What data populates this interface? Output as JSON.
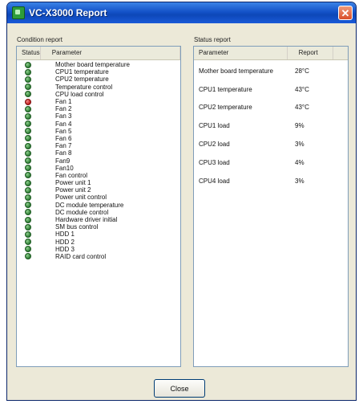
{
  "window": {
    "title": "VC-X3000 Report"
  },
  "condition": {
    "label": "Condition report",
    "col_status": "Status",
    "col_parameter": "Parameter",
    "rows": [
      {
        "status": "ok",
        "parameter": "Mother board temperature"
      },
      {
        "status": "ok",
        "parameter": "CPU1 temperature"
      },
      {
        "status": "ok",
        "parameter": "CPU2 temperature"
      },
      {
        "status": "ok",
        "parameter": "Temperature control"
      },
      {
        "status": "ok",
        "parameter": "CPU load control"
      },
      {
        "status": "error",
        "parameter": "Fan 1"
      },
      {
        "status": "ok",
        "parameter": "Fan 2"
      },
      {
        "status": "ok",
        "parameter": "Fan 3"
      },
      {
        "status": "ok",
        "parameter": "Fan 4"
      },
      {
        "status": "ok",
        "parameter": "Fan 5"
      },
      {
        "status": "ok",
        "parameter": "Fan 6"
      },
      {
        "status": "ok",
        "parameter": "Fan 7"
      },
      {
        "status": "ok",
        "parameter": "Fan 8"
      },
      {
        "status": "ok",
        "parameter": "Fan9"
      },
      {
        "status": "ok",
        "parameter": "Fan10"
      },
      {
        "status": "ok",
        "parameter": "Fan control"
      },
      {
        "status": "ok",
        "parameter": "Power unit 1"
      },
      {
        "status": "ok",
        "parameter": "Power unit 2"
      },
      {
        "status": "ok",
        "parameter": "Power unit control"
      },
      {
        "status": "ok",
        "parameter": "DC module temperature"
      },
      {
        "status": "ok",
        "parameter": "DC module control"
      },
      {
        "status": "ok",
        "parameter": "Hardware driver initial"
      },
      {
        "status": "ok",
        "parameter": "SM bus control"
      },
      {
        "status": "ok",
        "parameter": "HDD 1"
      },
      {
        "status": "ok",
        "parameter": "HDD 2"
      },
      {
        "status": "ok",
        "parameter": "HDD 3"
      },
      {
        "status": "ok",
        "parameter": "RAID card control"
      }
    ]
  },
  "status": {
    "label": "Status report",
    "col_parameter": "Parameter",
    "col_report": "Report",
    "rows": [
      {
        "parameter": "Mother board temperature",
        "report": "28°C"
      },
      {
        "parameter": "CPU1 temperature",
        "report": "43°C"
      },
      {
        "parameter": "CPU2 temperature",
        "report": "43°C"
      },
      {
        "parameter": "CPU1 load",
        "report": "9%"
      },
      {
        "parameter": "CPU2 load",
        "report": "3%"
      },
      {
        "parameter": "CPU3 load",
        "report": "4%"
      },
      {
        "parameter": "CPU4 load",
        "report": "3%"
      }
    ]
  },
  "buttons": {
    "close": "Close"
  }
}
